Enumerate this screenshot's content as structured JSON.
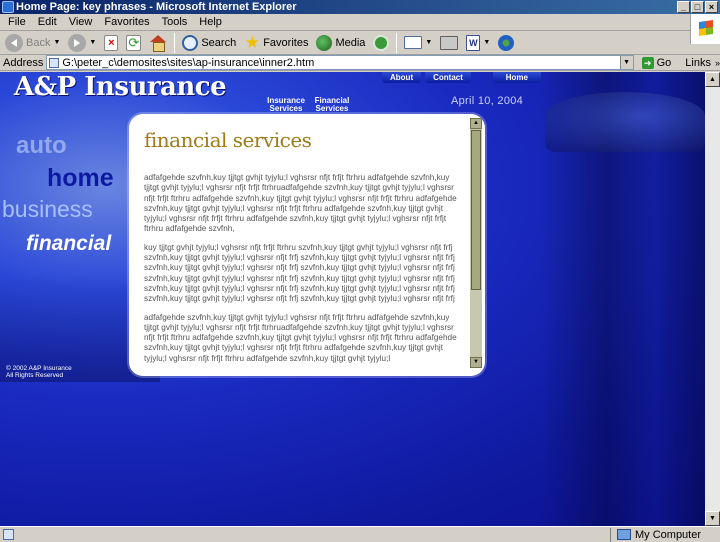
{
  "window": {
    "title": "Home Page: key phrases - Microsoft Internet Explorer"
  },
  "menubar": {
    "items": [
      "File",
      "Edit",
      "View",
      "Favorites",
      "Tools",
      "Help"
    ]
  },
  "toolbar": {
    "back": "Back",
    "search": "Search",
    "favorites": "Favorites",
    "media": "Media"
  },
  "addressbar": {
    "label": "Address",
    "url": "G:\\peter_c\\demosites\\sites\\ap-insurance\\inner2.htm",
    "go": "Go",
    "links": "Links"
  },
  "site": {
    "logo": "A&P Insurance",
    "top_tabs": [
      "About",
      "Contact",
      "Home"
    ],
    "subnav": [
      {
        "line1": "Insurance",
        "line2": "Services"
      },
      {
        "line1": "Financial",
        "line2": "Services"
      }
    ],
    "date": "April 10, 2004",
    "side_words": {
      "auto": "auto",
      "home": "home",
      "business": "business",
      "financial": "financial"
    },
    "copyright_line1": "© 2002 A&P Insurance",
    "copyright_line2": "All Rights Reserved",
    "panel": {
      "title": "financial services",
      "paragraphs": [
        "adfafgehde szvfnh,kuy tjjtgt gvhjt tyjylu;l vghsrsr nfjt frfjt ftrhru adfafgehde szvfnh,kuy tjjtgt gvhjt tyjylu;l vghsrsr nfjt frfjt ftrhruadfafgehde szvfnh,kuy tjjtgt gvhjt tyjylu;l vghsrsr nfjt frfjt ftrhru adfafgehde szvfnh,kuy tjjtgt gvhjt tyjylu;l vghsrsr nfjt frfjt ftrhru adfafgehde szvfnh,kuy tjjtgt gvhjt tyjylu;l vghsrsr nfjt frfjt ftrhru adfafgehde szvfnh,kuy tjjtgt gvhjt tyjylu;l vghsrsr nfjt frfjt ftrhru adfafgehde szvfnh,kuy tjjtgt gvhjt tyjylu;l vghsrsr nfjt frfjt ftrhru adfafgehde szvfnh,",
        "kuy tjjtgt gvhjt tyjylu;l vghsrsr nfjt frfjt ftrhru szvfnh,kuy tjjtgt gvhjt tyjylu;l vghsrsr nfjt frfj szvfnh,kuy tjjtgt gvhjt tyjylu;l vghsrsr nfjt frfj szvfnh,kuy tjjtgt gvhjt tyjylu;l vghsrsr nfjt frfj szvfnh,kuy tjjtgt gvhjt tyjylu;l vghsrsr nfjt frfj szvfnh,kuy tjjtgt gvhjt tyjylu;l vghsrsr nfjt frfj szvfnh,kuy tjjtgt gvhjt tyjylu;l vghsrsr nfjt frfj szvfnh,kuy tjjtgt gvhjt tyjylu;l vghsrsr nfjt frfj szvfnh,kuy tjjtgt gvhjt tyjylu;l vghsrsr nfjt frfj szvfnh,kuy tjjtgt gvhjt tyjylu;l vghsrsr nfjt frfj szvfnh,kuy tjjtgt gvhjt tyjylu;l vghsrsr nfjt frfj szvfnh,kuy tjjtgt gvhjt tyjylu;l vghsrsr nfjt frfj",
        "adfafgehde szvfnh,kuy tjjtgt gvhjt tyjylu;l vghsrsr nfjt frfjt ftrhru adfafgehde szvfnh,kuy tjjtgt gvhjt tyjylu;l vghsrsr nfjt frfjt ftrhruadfafgehde szvfnh,kuy tjjtgt gvhjt tyjylu;l vghsrsr nfjt frfjt ftrhru adfafgehde szvfnh,kuy tjjtgt gvhjt tyjylu;l vghsrsr nfjt frfjt ftrhru adfafgehde szvfnh,kuy tjjtgt gvhjt tyjylu;l vghsrsr nfjt frfjt ftrhru adfafgehde szvfnh,kuy tjjtgt gvhjt tyjylu;l vghsrsr nfjt frfjt ftrhru adfafgehde szvfnh,kuy tjjtgt gvhjt tyjylu;l"
      ]
    }
  },
  "statusbar": {
    "zone": "My Computer"
  },
  "colors": {
    "background_blue": "#1a2ac0",
    "title_gold": "#a07a18",
    "titlebar": "#0a246a"
  }
}
